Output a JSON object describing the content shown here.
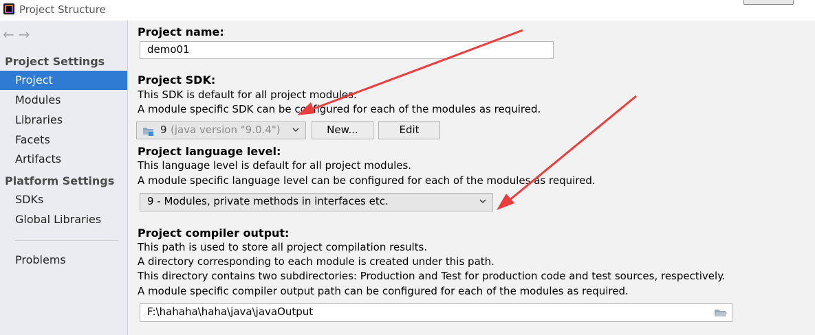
{
  "window": {
    "title": "Project Structure"
  },
  "sidebar": {
    "nav_back": "←",
    "nav_forward": "→",
    "project_settings_header": "Project Settings",
    "project_settings_items": [
      "Project",
      "Modules",
      "Libraries",
      "Facets",
      "Artifacts"
    ],
    "platform_settings_header": "Platform Settings",
    "platform_settings_items": [
      "SDKs",
      "Global Libraries"
    ],
    "problems": "Problems",
    "selected_item": "Project"
  },
  "project_name": {
    "label": "Project name:",
    "value": "demo01"
  },
  "project_sdk": {
    "label": "Project SDK:",
    "desc_line1": "This SDK is default for all project modules.",
    "desc_line2": "A module specific SDK can be configured for each of the modules as required.",
    "selected_version": "9",
    "selected_detail": "(java version \"9.0.4\")",
    "new_button": "New...",
    "edit_button": "Edit"
  },
  "language_level": {
    "label": "Project language level:",
    "desc_line1": "This language level is default for all project modules.",
    "desc_line2": "A module specific language level can be configured for each of the modules as required.",
    "selected": "9 - Modules, private methods in interfaces etc."
  },
  "compiler_output": {
    "label": "Project compiler output:",
    "desc_line1": "This path is used to store all project compilation results.",
    "desc_line2": "A directory corresponding to each module is created under this path.",
    "desc_line3": "This directory contains two subdirectories: Production and Test for production code and test sources, respectively.",
    "desc_line4": "A module specific compiler output path can be configured for each of the modules as required.",
    "path": "F:\\hahaha\\haha\\java\\javaOutput"
  },
  "colors": {
    "selection": "#2f7bd4",
    "sidebar_bg": "#eaecf1",
    "panel_bg": "#f2f2f2",
    "annotation_arrow": "#ee3b3b"
  }
}
